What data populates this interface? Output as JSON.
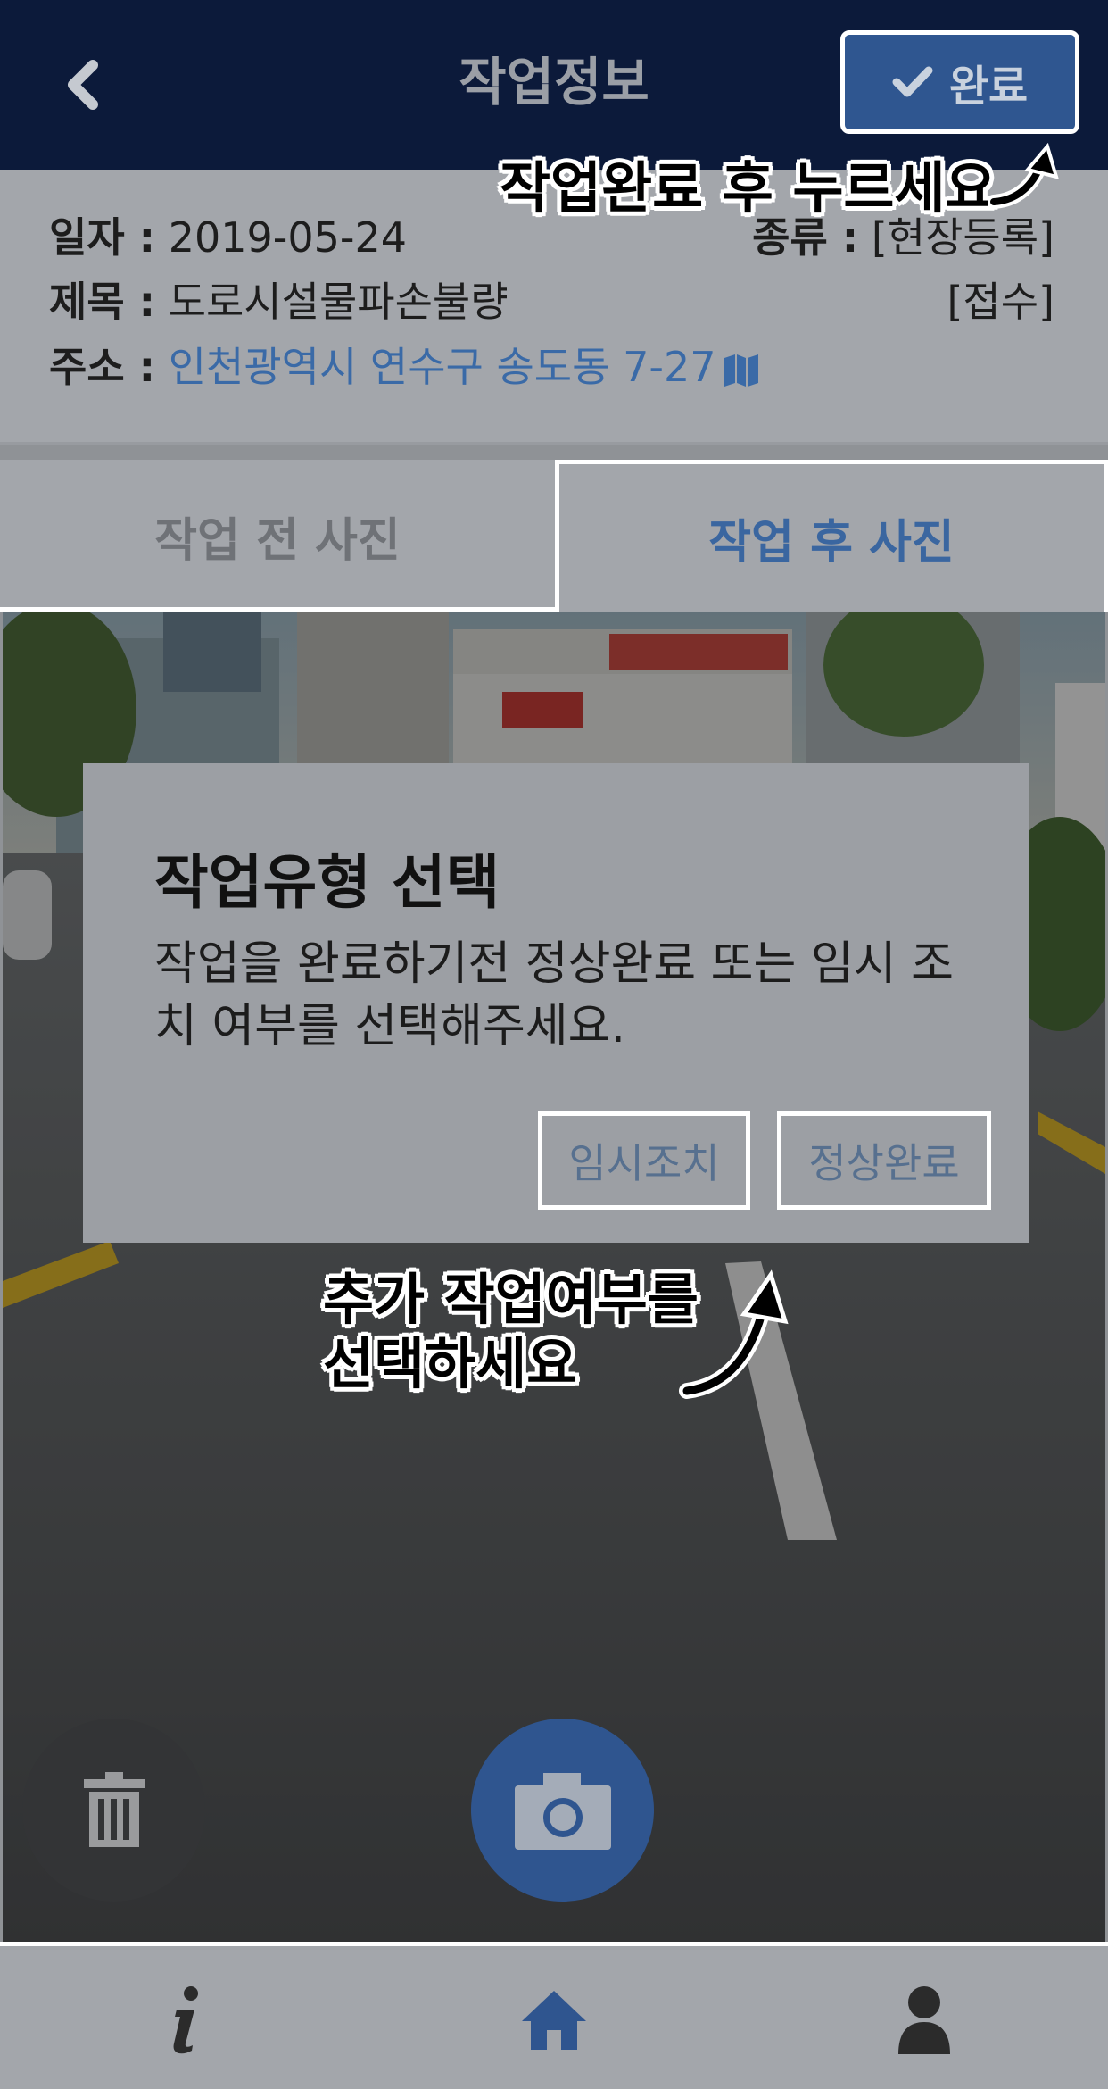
{
  "header": {
    "title": "작업정보",
    "done_label": "완료"
  },
  "info": {
    "date_label": "일자 :",
    "date_value": "2019-05-24",
    "type_label": "종류 :",
    "type_value": "[현장등록]",
    "subject_label": "제목 :",
    "subject_value": "도로시설물파손불량",
    "status_value": "[접수]",
    "address_label": "주소 :",
    "address_value": "인천광역시 연수구 송도동 7-27"
  },
  "guides": {
    "top": "작업완료 후 누르세요",
    "mid_line1": "추가 작업여부를",
    "mid_line2": "선택하세요"
  },
  "tabs": [
    {
      "label": "작업 전 사진",
      "active": false
    },
    {
      "label": "작업 후 사진",
      "active": true
    }
  ],
  "dialog": {
    "title": "작업유형 선택",
    "message": "작업을 완료하기전 정상완료 또는 임시 조치 여부를 선택해주세요.",
    "temp_button": "임시조치",
    "normal_button": "정상완료"
  },
  "icons": {
    "back": "chevron-left-icon",
    "done": "check-icon",
    "map": "map-icon",
    "trash": "trash-icon",
    "camera": "camera-icon",
    "info": "info-icon",
    "home": "home-icon",
    "user": "user-icon"
  },
  "colors": {
    "header_bg": "#0c1a3a",
    "accent_blue": "#2f5690",
    "link_blue": "#3a6aa7",
    "panel_gray": "#a3a6ab"
  }
}
